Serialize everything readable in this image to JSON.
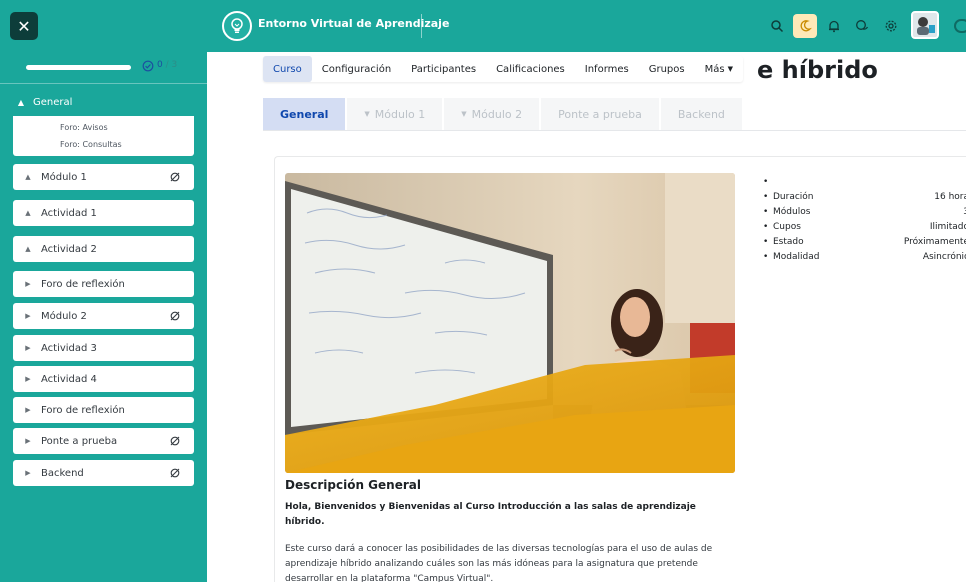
{
  "topbar": {
    "close_glyph": "✕",
    "site_title": "Entorno Virtual de Aprendizaje",
    "icons": [
      "search-icon",
      "moon-icon",
      "bell-icon",
      "chat-icon",
      "gear-icon"
    ],
    "accent": "#1aa79b"
  },
  "sidebar": {
    "progress_done": "0",
    "progress_total": "/ 3",
    "progress_fraction": 0,
    "general_label": "General",
    "general_links": [
      "Foro: Avisos",
      "Foro: Consultas"
    ],
    "items": [
      {
        "label": "Módulo 1",
        "hidden": true
      },
      {
        "label": "Actividad 1",
        "hidden": false
      },
      {
        "label": "Actividad 2",
        "hidden": false
      },
      {
        "label": "Foro de reflexión",
        "hidden": false
      },
      {
        "label": "Módulo 2",
        "hidden": true
      },
      {
        "label": "Actividad 3",
        "hidden": false
      },
      {
        "label": "Actividad 4",
        "hidden": false
      },
      {
        "label": "Foro de reflexión",
        "hidden": false
      },
      {
        "label": "Ponte a prueba",
        "hidden": true
      },
      {
        "label": "Backend",
        "hidden": true
      }
    ]
  },
  "main": {
    "course_title_visible": "e híbrido",
    "nav": [
      "Curso",
      "Configuración",
      "Participantes",
      "Calificaciones",
      "Informes",
      "Grupos",
      "Más"
    ],
    "tabs": [
      "General",
      "Módulo 1",
      "Módulo 2",
      "Ponte a prueba",
      "Backend"
    ],
    "description_title": "Descripción General",
    "description_subtitle": "Hola, Bienvenidos y Bienvenidas al Curso Introducción a las salas de aprendizaje híbrido.",
    "description_body": "Este curso dará a conocer las posibilidades de las diversas tecnologías para el uso de aulas de aprendizaje híbrido analizando cuáles son las más idóneas para la asignatura que pretende desarrollar en la plataforma \"Campus Virtual\".",
    "meta": [
      {
        "k": "",
        "v": ""
      },
      {
        "k": "Duración",
        "v": "16 hora"
      },
      {
        "k": "Módulos",
        "v": "3"
      },
      {
        "k": "Cupos",
        "v": "Ilimitado"
      },
      {
        "k": "Estado",
        "v": "Próximamente"
      },
      {
        "k": "Modalidad",
        "v": "Asincrónic"
      }
    ]
  }
}
